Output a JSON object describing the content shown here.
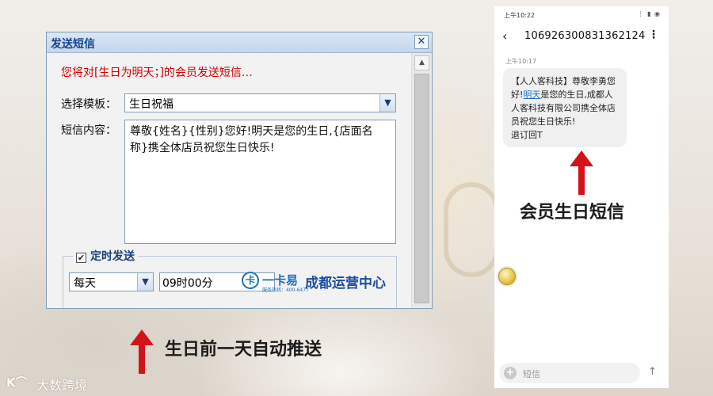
{
  "dialog": {
    "title": "发送短信",
    "close_label": "✕",
    "notice": "您将对[生日为明天；]的会员发送短信…",
    "template_label": "选择模板：",
    "template_value": "生日祝福",
    "content_label": "短信内容：",
    "content_text": "尊敬{姓名}{性别}您好!明天是您的生日,{店面名称}携全体店员祝您生日快乐!",
    "schedule_checked": true,
    "schedule_label": "定时发送",
    "frequency_value": "每天",
    "time_value": "09时00分",
    "watermark": {
      "brand": "一卡易",
      "sub": "服务热线：400-6477",
      "region": "成都运营中心"
    }
  },
  "captions": {
    "left": "生日前一天自动推送",
    "right": "会员生日短信"
  },
  "phone": {
    "status_time": "上午10:22",
    "status_icons": "⋮ ▮ ◉",
    "sender": "106926300831362124",
    "message_time": "上午10:17",
    "message_prefix": "【人人客科技】尊敬李勇您好!",
    "message_link": "明天",
    "message_suffix": "是您的生日,成都人人客科技有限公司携全体店员祝您生日快乐!\n退订回T",
    "input_placeholder": "短信"
  },
  "corner_logo": {
    "mark": "K⌒",
    "text": "大数跨境"
  },
  "colors": {
    "accent_red": "#d4121a",
    "notice_red": "#d40000",
    "title_blue": "#15428b",
    "link_blue": "#1f6fd0"
  },
  "icons": {
    "close": "close-icon",
    "dropdown": "chevron-down-icon",
    "back": "back-arrow-icon",
    "more": "more-vertical-icon",
    "send": "send-arrow-icon",
    "add": "plus-icon"
  }
}
